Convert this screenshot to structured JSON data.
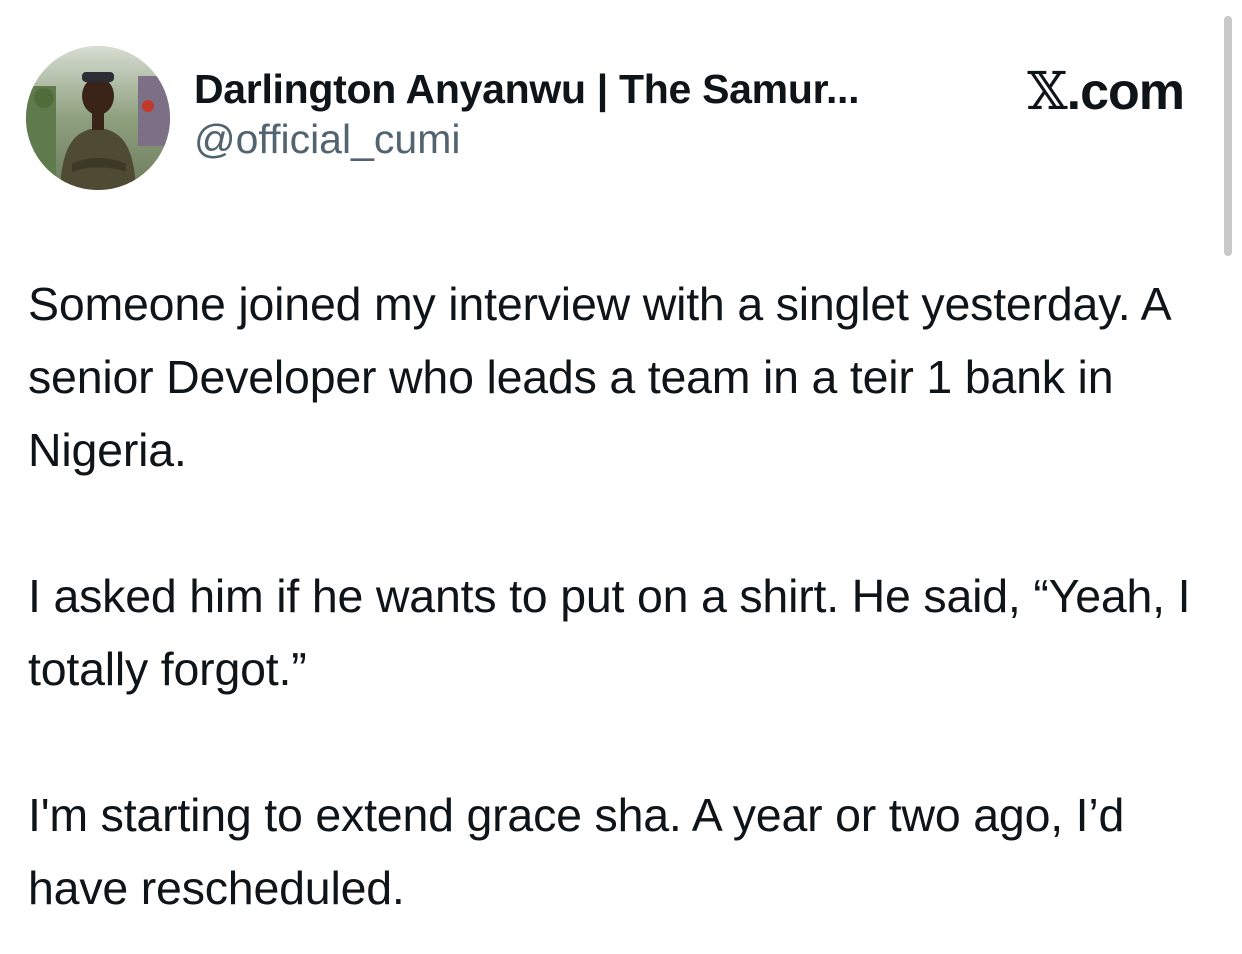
{
  "post": {
    "author": {
      "display_name": "Darlington Anyanwu | The Samur...",
      "handle": "@official_cumi",
      "avatar": "profile-photo"
    },
    "brand": {
      "glyph": "𝕏",
      "suffix": ".com"
    },
    "paragraphs": [
      "Someone joined my interview with a singlet yesterday. A senior Developer who leads a team in a teir 1 bank in Nigeria.",
      "I asked him if he wants to put on a shirt. He said, “Yeah, I totally forgot.”",
      "I'm starting to extend grace sha. A year or two ago, I’d have rescheduled."
    ]
  },
  "colors": {
    "text_primary": "#0f1419",
    "text_secondary": "#536471",
    "background": "#ffffff",
    "scrollbar": "#c9c9c9"
  }
}
